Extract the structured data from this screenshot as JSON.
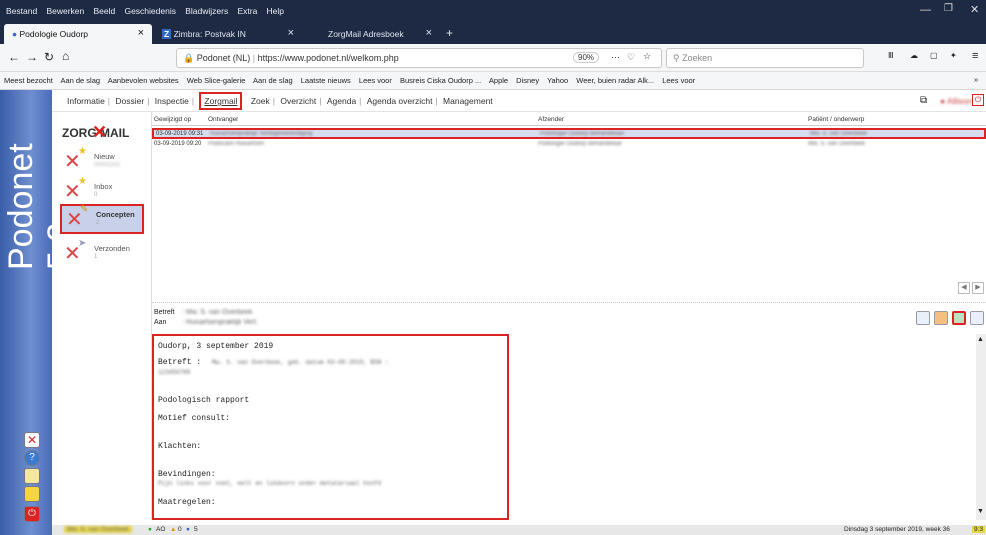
{
  "menu": [
    "Bestand",
    "Bewerken",
    "Beeld",
    "Geschiedenis",
    "Bladwijzers",
    "Extra",
    "Help"
  ],
  "tabs": [
    {
      "label": "Podologie Oudorp",
      "close": "×"
    },
    {
      "label": "Zimbra: Postvak IN",
      "close": "×"
    },
    {
      "label": "ZorgMail Adresboek",
      "close": "×"
    }
  ],
  "new_tab": "+",
  "url": {
    "site": "Podonet (NL)",
    "address": "https://www.podonet.nl/welkom.php",
    "zoom": "90%"
  },
  "search": {
    "placeholder": "Zoeken"
  },
  "bookmarks": [
    "Meest bezocht",
    "Aan de slag",
    "Aanbevolen websites",
    "Web Slice-galerie",
    "Aan de slag",
    "Laatste nieuws",
    "Lees voor",
    "Busreis Ciska Oudorp ...",
    "Apple",
    "Disney",
    "Yahoo",
    "Weer, buien radar Alk...",
    "Lees voor"
  ],
  "brand": "Podonet 5.2",
  "topnav": [
    "Informatie",
    "Dossier",
    "Inspectie",
    "Zorgmail",
    "Zoek",
    "Overzicht",
    "Agenda",
    "Agenda overzicht",
    "Management"
  ],
  "zorgmail_logo": "ZORG MAIL",
  "folders": [
    {
      "label": "Nieuw",
      "count": "00001101"
    },
    {
      "label": "Inbox",
      "count": "0"
    },
    {
      "label": "Concepten",
      "count": "2"
    },
    {
      "label": "Verzonden",
      "count": "1"
    }
  ],
  "columns": [
    "Gewijzigd op",
    "Ontvanger",
    "Afzender",
    "Patiënt / onderwerp"
  ],
  "rows": [
    {
      "date": "03-09-2019 09:31",
      "to": "Huisartsenpraktijk Vertegenwoordiging",
      "from": "Podologie Oudorp Behandelaar",
      "subject": "Mw. S. van Overbeek"
    },
    {
      "date": "03-09-2019 09:20",
      "to": "Podocare Huisartsen",
      "from": "Podologie Oudorp Behandelaar",
      "subject": "Mw. S. van Overbeek"
    }
  ],
  "preview": {
    "betreft_label": "Betreft",
    "betreft_value": ": Mw. S. van Overbeek",
    "aan_label": "Aan",
    "aan_value": ": Huisartsenpraktijk Vert."
  },
  "editor": {
    "line1": "Oudorp, 3 september 2019",
    "line2_label": "Betreft :",
    "line2_value": "Mw. S. van Overbeek, geb. datum 03-09-2019, BSN :",
    "line3": "123456789",
    "line4": "Podologisch rapport",
    "line5": "Motief consult:",
    "line6": "Klachten:",
    "line7": "Bevindingen:",
    "line8": "Pijn links voor voet, eelt en likdoorn onder metatarsaal hoofd",
    "line9": "Maatregelen:"
  },
  "statusbar": {
    "user": "Mw. S. van Overbeek",
    "ao": "AO",
    "a0": "0",
    "g5": "5",
    "date": "Dinsdag 3 september 2019, week 36",
    "time": "9:3"
  }
}
